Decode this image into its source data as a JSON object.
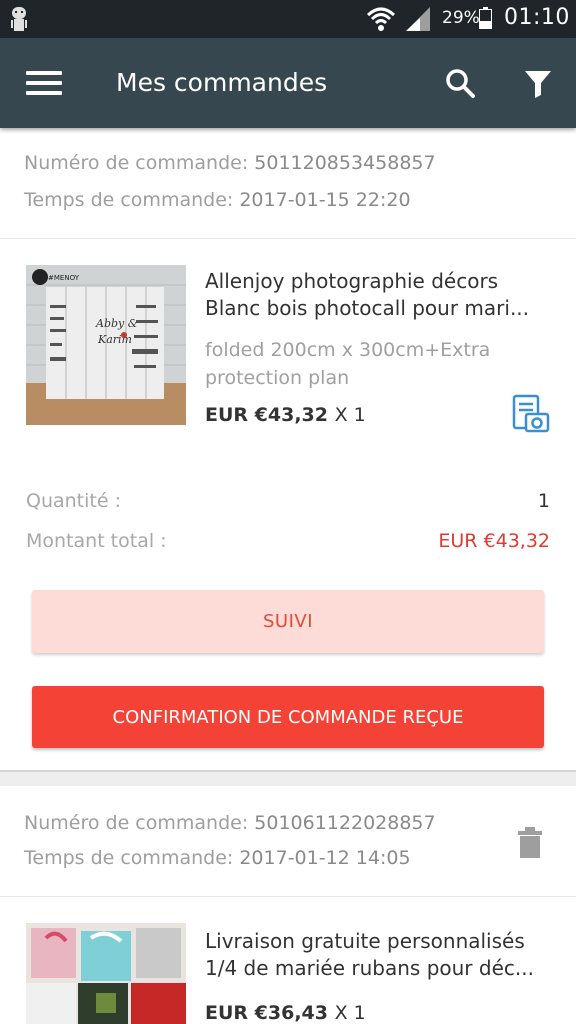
{
  "status_bar": {
    "battery": "29%",
    "time": "01:10"
  },
  "app_bar": {
    "title": "Mes commandes",
    "icons": [
      "menu-icon",
      "search-icon",
      "filter-icon"
    ]
  },
  "orders": [
    {
      "order_number_label": "Numéro de commande:",
      "order_number": "501120853458857",
      "order_time_label": "Temps de commande:",
      "order_time": "2017-01-15 22:20",
      "product": {
        "title": "Allenjoy photographie décors Blanc bois photocall pour mari...",
        "variant": "folded 200cm x 300cm+Extra protection plan",
        "price": "EUR €43,32",
        "qty": "X 1"
      },
      "quantity_label": "Quantité :",
      "quantity_value": "1",
      "total_label": "Montant total :",
      "total_value": "EUR €43,32",
      "track_button": "SUIVI",
      "confirm_button": "CONFIRMATION DE COMMANDE REÇUE"
    },
    {
      "order_number_label": "Numéro de commande:",
      "order_number": "501061122028857",
      "order_time_label": "Temps de commande:",
      "order_time": "2017-01-12 14:05",
      "product": {
        "title": "Livraison gratuite personnalisés 1/4 de mariée rubans pour déc...",
        "price": "EUR €36,43",
        "qty": "X 1"
      }
    }
  ],
  "colors": {
    "app_bar": "#37474f",
    "status_bar": "#1f2529",
    "accent_red": "#f44336",
    "track_bg": "#fddbd7"
  }
}
